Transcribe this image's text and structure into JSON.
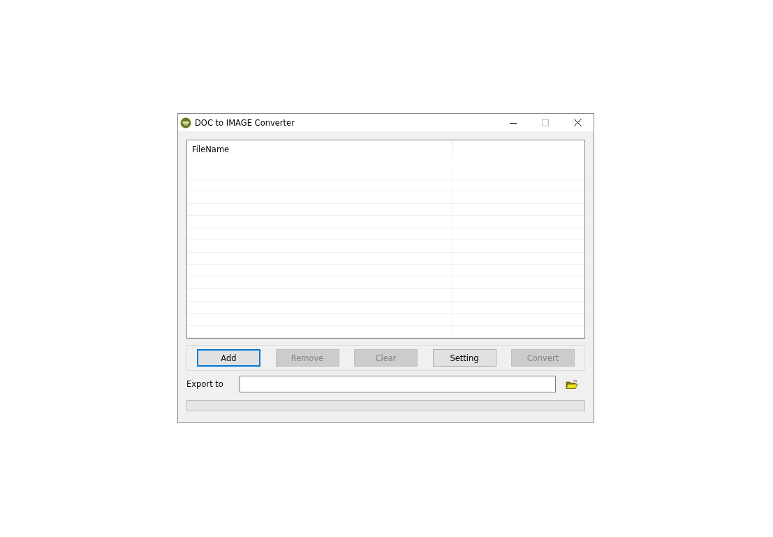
{
  "window": {
    "title": "DOC to IMAGE Converter"
  },
  "table": {
    "columns": [
      "FileName"
    ]
  },
  "buttons": [
    {
      "label": "Add",
      "disabled": false,
      "focused": true
    },
    {
      "label": "Remove",
      "disabled": true,
      "focused": false
    },
    {
      "label": "Clear",
      "disabled": true,
      "focused": false
    },
    {
      "label": "Setting",
      "disabled": false,
      "focused": false
    },
    {
      "label": "Convert",
      "disabled": true,
      "focused": false
    }
  ],
  "export": {
    "label": "Export to"
  },
  "progress": {
    "level": 0
  }
}
